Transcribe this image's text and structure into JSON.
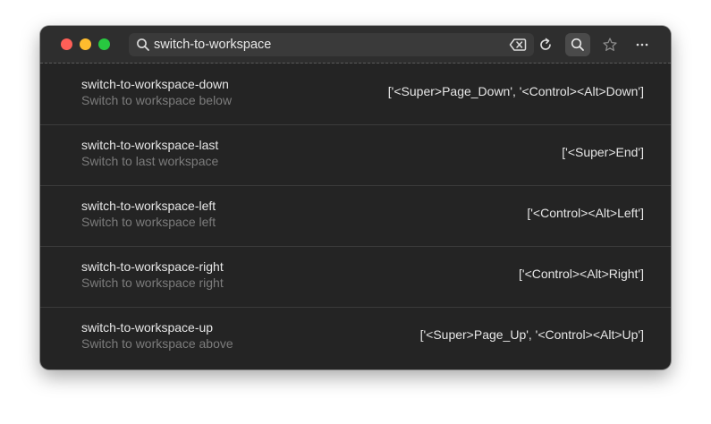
{
  "search": {
    "value": "switch-to-workspace"
  },
  "icons": {
    "search": "search-icon",
    "clear": "backspace-icon",
    "refresh": "refresh-icon",
    "search_toggle": "search-icon",
    "star": "star-icon",
    "menu": "more-horizontal-icon"
  },
  "colors": {
    "window_bg": "#242424",
    "titlebar_bg": "#2e2e2e",
    "close": "#ff5f57",
    "minimize": "#febc2e",
    "maximize": "#28c840"
  },
  "rows": [
    {
      "name": "switch-to-workspace-down",
      "description": "Switch to workspace below",
      "binding": "['<Super>Page_Down', '<Control><Alt>Down']"
    },
    {
      "name": "switch-to-workspace-last",
      "description": "Switch to last workspace",
      "binding": "['<Super>End']"
    },
    {
      "name": "switch-to-workspace-left",
      "description": "Switch to workspace left",
      "binding": "['<Control><Alt>Left']"
    },
    {
      "name": "switch-to-workspace-right",
      "description": "Switch to workspace right",
      "binding": "['<Control><Alt>Right']"
    },
    {
      "name": "switch-to-workspace-up",
      "description": "Switch to workspace above",
      "binding": "['<Super>Page_Up', '<Control><Alt>Up']"
    }
  ]
}
